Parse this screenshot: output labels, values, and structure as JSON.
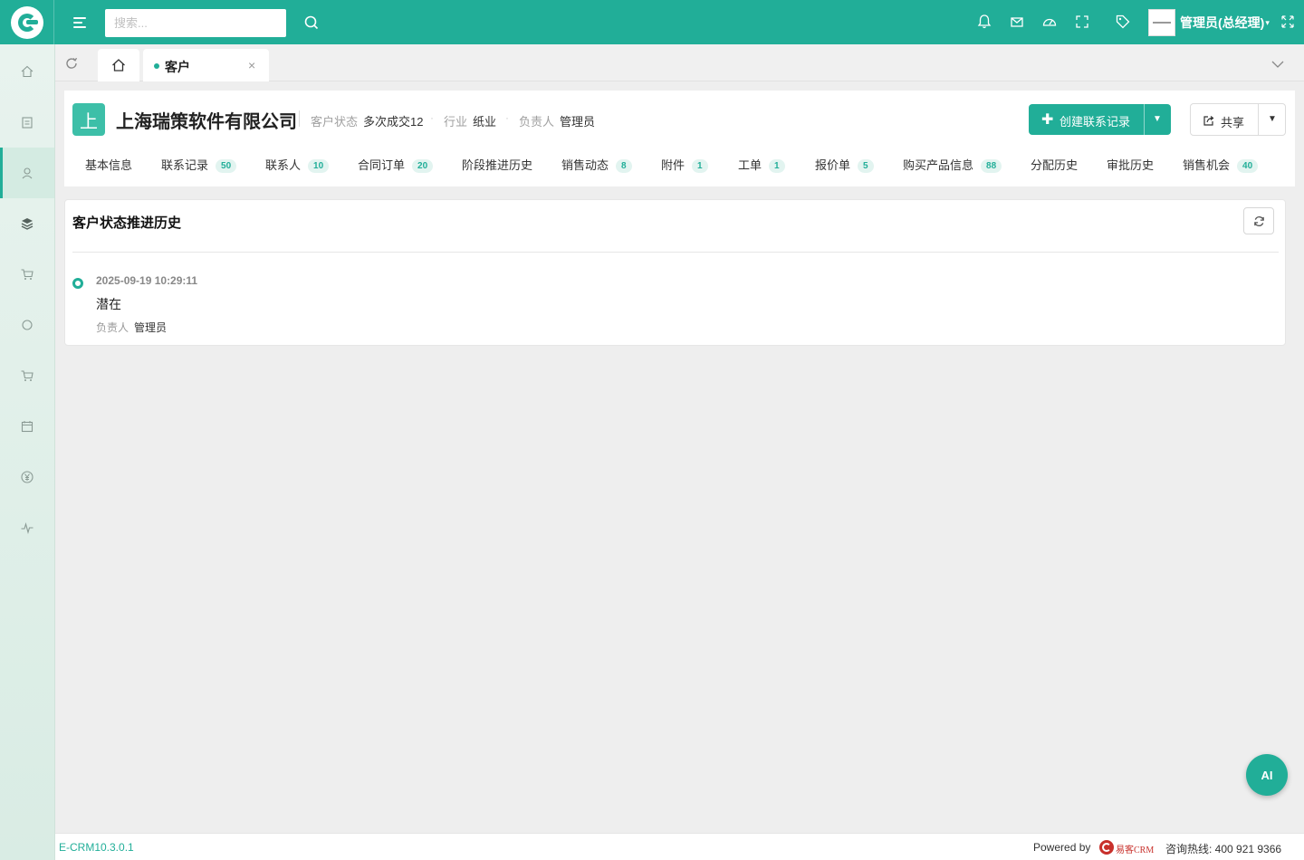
{
  "topbar": {
    "search_placeholder": "搜索...",
    "user_name": "管理员(总经理)",
    "user_caret": "▾",
    "icons": [
      "menu-icon",
      "search-icon",
      "bell-icon",
      "mail-icon",
      "dashboard-icon",
      "expand-icon",
      "tag-icon",
      "fullscreen-icon"
    ]
  },
  "sidebar": {
    "items": [
      "home-icon",
      "clipboard-icon",
      "customer-icon",
      "layers-icon",
      "cart-icon",
      "circle-icon",
      "cart2-icon",
      "calendar-icon",
      "yen-icon",
      "activity-icon"
    ],
    "active_index": 2
  },
  "tabs": {
    "current_tab": "客户",
    "close": "×"
  },
  "customer": {
    "avatar_letter": "上",
    "name": "上海瑞策软件有限公司",
    "meta": [
      {
        "key": "客户状态",
        "value": "多次成交12"
      },
      {
        "key": "行业",
        "value": "纸业"
      },
      {
        "key": "负责人",
        "value": "管理员"
      }
    ],
    "meta_dot": "·",
    "create_button": "创建联系记录",
    "create_plus": "✚",
    "share_button": "共享",
    "caret": "▼"
  },
  "subtabs": [
    {
      "label": "基本信息",
      "badge": ""
    },
    {
      "label": "联系记录",
      "badge": "50"
    },
    {
      "label": "联系人",
      "badge": "10"
    },
    {
      "label": "合同订单",
      "badge": "20"
    },
    {
      "label": "阶段推进历史",
      "badge": ""
    },
    {
      "label": "销售动态",
      "badge": "8"
    },
    {
      "label": "附件",
      "badge": "1"
    },
    {
      "label": "工单",
      "badge": "1"
    },
    {
      "label": "报价单",
      "badge": "5"
    },
    {
      "label": "购买产品信息",
      "badge": "88"
    },
    {
      "label": "分配历史",
      "badge": ""
    },
    {
      "label": "审批历史",
      "badge": ""
    },
    {
      "label": "销售机会",
      "badge": "40"
    }
  ],
  "panel": {
    "title": "客户状态推进历史",
    "timeline": [
      {
        "time": "2025-09-19 10:29:11",
        "status": "潜在",
        "owner_label": "负责人",
        "owner": "管理员"
      }
    ]
  },
  "footer": {
    "version": "E-CRM10.3.0.1",
    "powered_by": "Powered by",
    "brand": "易客CRM",
    "hotline": "咨询热线: 400 921 9366"
  },
  "ai_button": "AI",
  "colors": {
    "primary": "#21ae98",
    "brand_red": "#c8302b"
  }
}
